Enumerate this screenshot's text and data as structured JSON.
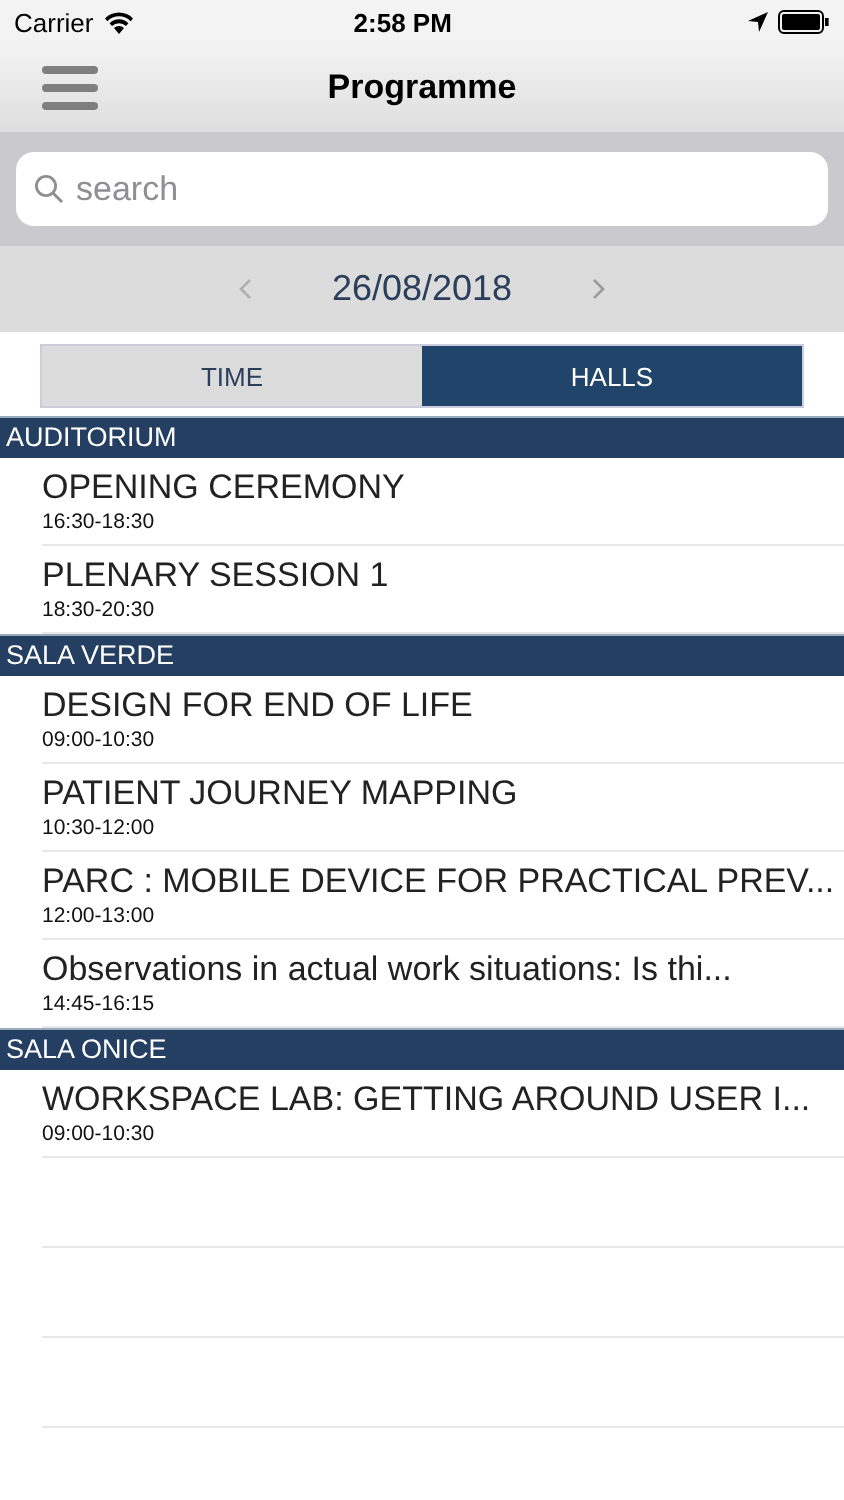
{
  "status_bar": {
    "carrier": "Carrier",
    "time": "2:58 PM"
  },
  "nav": {
    "title": "Programme"
  },
  "search": {
    "placeholder": "search"
  },
  "date_bar": {
    "date": "26/08/2018"
  },
  "tabs": [
    {
      "label": "TIME",
      "selected": false
    },
    {
      "label": "HALLS",
      "selected": true
    }
  ],
  "sections": [
    {
      "hall": "AUDITORIUM",
      "sessions": [
        {
          "title": "OPENING CEREMONY",
          "time": "16:30-18:30"
        },
        {
          "title": "PLENARY SESSION 1",
          "time": "18:30-20:30"
        }
      ]
    },
    {
      "hall": "SALA VERDE",
      "sessions": [
        {
          "title": "DESIGN FOR END OF LIFE",
          "time": "09:00-10:30"
        },
        {
          "title": "PATIENT JOURNEY MAPPING",
          "time": "10:30-12:00"
        },
        {
          "title": "PARC : MOBILE DEVICE FOR PRACTICAL PREV...",
          "time": "12:00-13:00"
        },
        {
          "title": "Observations in actual work situations: Is thi...",
          "time": "14:45-16:15"
        }
      ]
    },
    {
      "hall": "SALA ONICE",
      "sessions": [
        {
          "title": "WORKSPACE LAB: GETTING AROUND USER I...",
          "time": "09:00-10:30"
        }
      ]
    }
  ]
}
